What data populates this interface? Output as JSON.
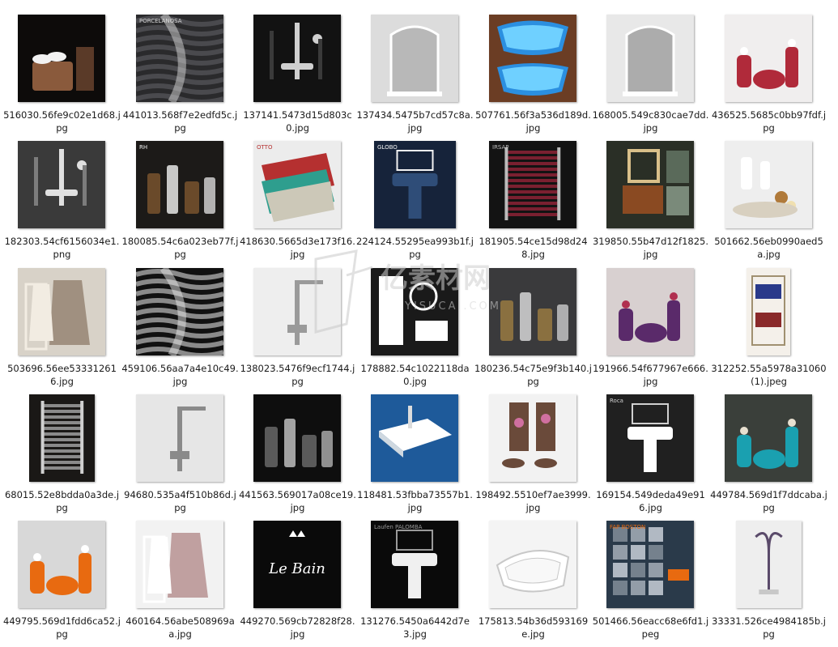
{
  "files": [
    {
      "name": "516030.56fe9c02e1d68.jpg",
      "thumb": {
        "bg": "#0d0b0a",
        "fg": "#8a5a3c",
        "accent": "#f2f2f2",
        "motif": "towel-basket"
      }
    },
    {
      "name": "441013.568f7e2edfd5c.jpg",
      "thumb": {
        "bg": "#2a2a2c",
        "fg": "#4a4a4e",
        "accent": "#d8d8d8",
        "motif": "wave-tile",
        "caption": "PORCELANOSA"
      }
    },
    {
      "name": "137141.5473d15d803c0.jpg",
      "thumb": {
        "bg": "#121212",
        "fg": "#3a3a3a",
        "accent": "#cfcfcf",
        "motif": "shower-set"
      }
    },
    {
      "name": "137434.5475b7cd57c8a.jpg",
      "thumb": {
        "bg": "#dcdcdc",
        "fg": "#9a9a9a",
        "accent": "#ffffff",
        "motif": "shower-cabin"
      }
    },
    {
      "name": "507761.56f3a536d189d.jpg",
      "thumb": {
        "bg": "#6b3d24",
        "fg": "#2b8fe0",
        "accent": "#6fd0ff",
        "motif": "pool"
      }
    },
    {
      "name": "168005.549c830cae7dd.jpg",
      "thumb": {
        "bg": "#e8e8e8",
        "fg": "#7a7a7a",
        "accent": "#ffffff",
        "motif": "shower-cabin"
      }
    },
    {
      "name": "436525.5685c0bb97fdf.jpg",
      "thumb": {
        "bg": "#f0eeee",
        "fg": "#b02a3a",
        "accent": "#ffffff",
        "motif": "cherry-set"
      }
    },
    {
      "name": "182303.54cf6156034e1.png",
      "thumb": {
        "bg": "#3a3a3a",
        "fg": "#7c7c7c",
        "accent": "#e0e0e0",
        "motif": "faucets"
      }
    },
    {
      "name": "180085.54c6a023eb77f.jpg",
      "thumb": {
        "bg": "#1c1a18",
        "fg": "#6a4a2a",
        "accent": "#f4f4f4",
        "motif": "bottles",
        "caption": "RH"
      }
    },
    {
      "name": "418630.5665d3e173f16.jpg",
      "thumb": {
        "bg": "#ececec",
        "fg": "#2e9e8e",
        "accent": "#b53030",
        "motif": "mats",
        "caption": "OTTO"
      }
    },
    {
      "name": "224124.55295ea993b1f.jpg",
      "thumb": {
        "bg": "#16233a",
        "fg": "#2f4d78",
        "accent": "#f2f2f2",
        "motif": "sink-set",
        "caption": "GLOBO"
      }
    },
    {
      "name": "181905.54ce15d98d248.jpg",
      "thumb": {
        "bg": "#131313",
        "fg": "#7a2030",
        "accent": "#bbbbbb",
        "motif": "radiator",
        "caption": "IRSAP"
      }
    },
    {
      "name": "319850.55b47d12f1825.jpg",
      "thumb": {
        "bg": "#2a2f26",
        "fg": "#8a4a22",
        "accent": "#d9c08a",
        "motif": "vanity"
      }
    },
    {
      "name": "501662.56eb0990aed5a.jpg",
      "thumb": {
        "bg": "#eeeeee",
        "fg": "#b07a3a",
        "accent": "#ffffff",
        "motif": "flowers"
      }
    },
    {
      "name": "503696.56ee533312616.jpg",
      "thumb": {
        "bg": "#d8d2c8",
        "fg": "#a09080",
        "accent": "#f2ece2",
        "motif": "robe-shelf"
      }
    },
    {
      "name": "459106.56aa7a4e10c49.jpg",
      "thumb": {
        "bg": "#111111",
        "fg": "#8a8a8a",
        "accent": "#e8e8e8",
        "motif": "wave-panel"
      }
    },
    {
      "name": "138023.5476f9ecf1744.jpg",
      "thumb": {
        "bg": "#eeeeee",
        "fg": "#9a9a9a",
        "accent": "#ffffff",
        "motif": "faucet"
      }
    },
    {
      "name": "178882.54c1022118da0.jpg",
      "thumb": {
        "bg": "#1a1a1a",
        "fg": "#5a5a5a",
        "accent": "#ffffff",
        "motif": "cabinet"
      }
    },
    {
      "name": "180236.54c75e9f3b140.jpg",
      "thumb": {
        "bg": "#3a3a3c",
        "fg": "#8a7040",
        "accent": "#e0e0e0",
        "motif": "jars"
      }
    },
    {
      "name": "191966.54f677967e666.jpg",
      "thumb": {
        "bg": "#d8d0d0",
        "fg": "#5a2a6a",
        "accent": "#b03050",
        "motif": "purple-set"
      }
    },
    {
      "name": "312252.55a5978a31060 (1).jpeg",
      "thumb": {
        "bg": "#f4f0ea",
        "fg": "#2a3a8a",
        "accent": "#8a2a2a",
        "motif": "towel-rack"
      }
    },
    {
      "name": "68015.52e8bdda0a3de.jpg",
      "thumb": {
        "bg": "#1a1816",
        "fg": "#8a8a8a",
        "accent": "#d0d0d0",
        "motif": "radiator"
      }
    },
    {
      "name": "94680.535a4f510b86d.jpg",
      "thumb": {
        "bg": "#e6e6e6",
        "fg": "#8a8a8a",
        "accent": "#ffffff",
        "motif": "shower-column"
      }
    },
    {
      "name": "441563.569017a08ce19.jpg",
      "thumb": {
        "bg": "#0e0e0e",
        "fg": "#5a5a5a",
        "accent": "#c8c8c8",
        "motif": "dark-set"
      }
    },
    {
      "name": "118481.53fbba73557b1.jpg",
      "thumb": {
        "bg": "#1e5a9a",
        "fg": "#ffffff",
        "accent": "#dcdcdc",
        "motif": "sink"
      }
    },
    {
      "name": "198492.5510ef7ae3999.jpg",
      "thumb": {
        "bg": "#f2f2f2",
        "fg": "#6a4a3a",
        "accent": "#d070a0",
        "motif": "towels"
      }
    },
    {
      "name": "169154.549deda49e916.jpg",
      "thumb": {
        "bg": "#202020",
        "fg": "#ffffff",
        "accent": "#d0d0d0",
        "motif": "pedestal",
        "caption": "Roca"
      }
    },
    {
      "name": "449784.569d1f7ddcaba.jpg",
      "thumb": {
        "bg": "#3a3f3a",
        "fg": "#1aa0b0",
        "accent": "#e8e0d0",
        "motif": "turquoise-set"
      }
    },
    {
      "name": "449795.569d1fdd6ca52.jpg",
      "thumb": {
        "bg": "#d8d8d8",
        "fg": "#e86a10",
        "accent": "#ffffff",
        "motif": "orange-set"
      }
    },
    {
      "name": "460164.56abe508969aa.jpg",
      "thumb": {
        "bg": "#f2f2f2",
        "fg": "#c0a0a0",
        "accent": "#ffffff",
        "motif": "robes"
      }
    },
    {
      "name": "449270.569cb72828f28.jpg",
      "thumb": {
        "bg": "#0a0a0a",
        "fg": "#ffffff",
        "accent": "#cfcfcf",
        "motif": "logo-text",
        "caption": "Le Bain"
      }
    },
    {
      "name": "131276.5450a6442d7e3.jpg",
      "thumb": {
        "bg": "#0a0a0a",
        "fg": "#f0f0f0",
        "accent": "#9a9a9a",
        "motif": "washbasin",
        "caption": "Laufen PALOMBA"
      }
    },
    {
      "name": "175813.54b36d593169e.jpg",
      "thumb": {
        "bg": "#f4f4f4",
        "fg": "#ffffff",
        "accent": "#c8c8c8",
        "motif": "bathtub"
      }
    },
    {
      "name": "501466.56eacc68e6fd1.jpeg",
      "thumb": {
        "bg": "#2a3a4a",
        "fg": "#c0c8d0",
        "accent": "#e86a10",
        "motif": "tile-samples",
        "caption": "FAP BOSTON"
      }
    },
    {
      "name": "33331.526ce4984185b.jpg",
      "thumb": {
        "bg": "#eeeeee",
        "fg": "#5a4a6a",
        "accent": "#c8c8c8",
        "motif": "hooks"
      }
    }
  ],
  "watermark": {
    "text_cn": "亿素材网",
    "text_en": "YISUCAI.COM"
  }
}
